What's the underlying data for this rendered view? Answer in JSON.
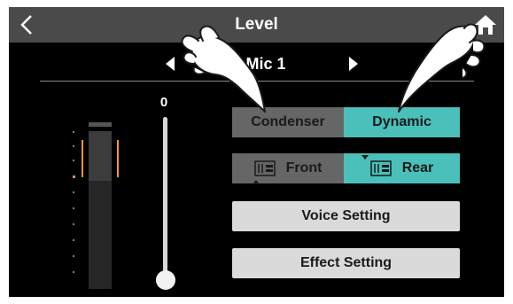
{
  "header": {
    "title": "Level",
    "back_icon": "chevron-left-icon",
    "home_icon": "home-icon"
  },
  "input_selector": {
    "label": "Mic 1",
    "prev_icon": "triangle-left-icon",
    "next_icon": "triangle-right-icon"
  },
  "fader": {
    "value_label": "0",
    "level": 0.0
  },
  "mic_type": {
    "options": [
      "Condenser",
      "Dynamic"
    ],
    "selected": "Dynamic"
  },
  "position": {
    "options": [
      "Front",
      "Rear"
    ],
    "selected": "Rear"
  },
  "buttons": {
    "voice_setting": "Voice Setting",
    "effect_setting": "Effect Setting"
  },
  "overlays": {
    "hand_icon": "pointing-hand-icon"
  },
  "colors": {
    "accent": "#4bbfba",
    "inactive": "#666666",
    "topbar": "#4a4a4a",
    "button": "#dadada",
    "meter_peak": "#f39a2b"
  }
}
